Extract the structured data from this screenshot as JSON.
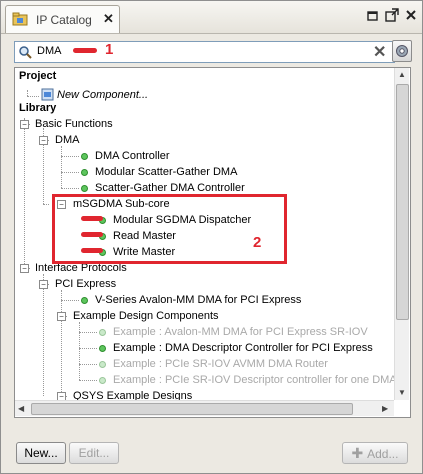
{
  "window": {
    "tab_title": "IP Catalog",
    "tab_icon": "ip-catalog-icon",
    "controls": [
      "restore-icon",
      "detach-icon",
      "close-icon"
    ]
  },
  "search": {
    "value": "DMA",
    "clear_icon": "clear-icon",
    "options_icon": "gear-icon"
  },
  "annotations": {
    "marker_1": "1",
    "marker_2": "2",
    "color": "#e0262f"
  },
  "tree": {
    "project_heading": "Project",
    "new_component": "New Component...",
    "library_heading": "Library",
    "basic_functions": "Basic Functions",
    "dma": "DMA",
    "dma_controller": "DMA Controller",
    "modular_sg_dma": "Modular Scatter-Gather DMA",
    "sg_dma_controller": "Scatter-Gather DMA Controller",
    "msgdma_subcore": "mSGDMA Sub-core",
    "msgdma_dispatcher": "Modular SGDMA Dispatcher",
    "read_master": "Read Master",
    "write_master": "Write Master",
    "interface_protocols": "Interface Protocols",
    "pci_express": "PCI Express",
    "vseries_dma": "V-Series Avalon-MM DMA for PCI Express",
    "example_design_components": "Example Design Components",
    "ex_sriov": "Example : Avalon-MM DMA for PCI Express SR-IOV",
    "ex_descriptor": "Example : DMA Descriptor Controller for PCI Express",
    "ex_avmm_router": "Example : PCIe SR-IOV AVMM DMA Router",
    "ex_sriov_desc": "Example : PCIe SR-IOV Descriptor controller for one DMA",
    "qsys_examples": "QSYS Example Designs"
  },
  "colors": {
    "ip_dot": "#5dc55d",
    "disabled_text": "#a9a9a9"
  },
  "footer": {
    "new_label": "New...",
    "edit_label": "Edit...",
    "add_label": "Add..."
  }
}
